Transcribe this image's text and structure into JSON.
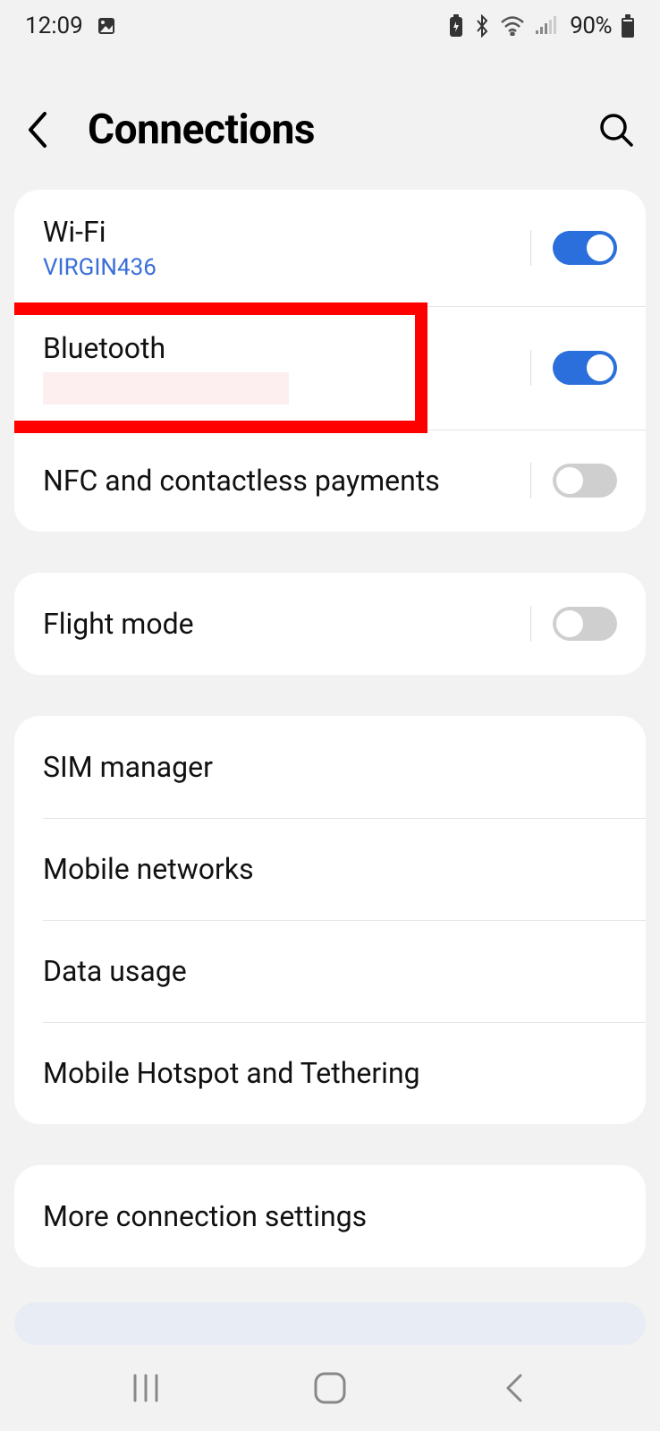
{
  "status_bar": {
    "time": "12:09",
    "battery_pct": "90%"
  },
  "header": {
    "title": "Connections"
  },
  "groups": [
    {
      "items": [
        {
          "title": "Wi-Fi",
          "sub": "VIRGIN436",
          "toggle": "on"
        },
        {
          "title": "Bluetooth",
          "sub_redacted": true,
          "toggle": "on",
          "highlight": true
        },
        {
          "title": "NFC and contactless payments",
          "toggle": "off"
        }
      ]
    },
    {
      "items": [
        {
          "title": "Flight mode",
          "toggle": "off"
        }
      ]
    },
    {
      "items": [
        {
          "title": "SIM manager"
        },
        {
          "title": "Mobile networks"
        },
        {
          "title": "Data usage"
        },
        {
          "title": "Mobile Hotspot and Tethering"
        }
      ]
    },
    {
      "items": [
        {
          "title": "More connection settings"
        }
      ]
    }
  ]
}
